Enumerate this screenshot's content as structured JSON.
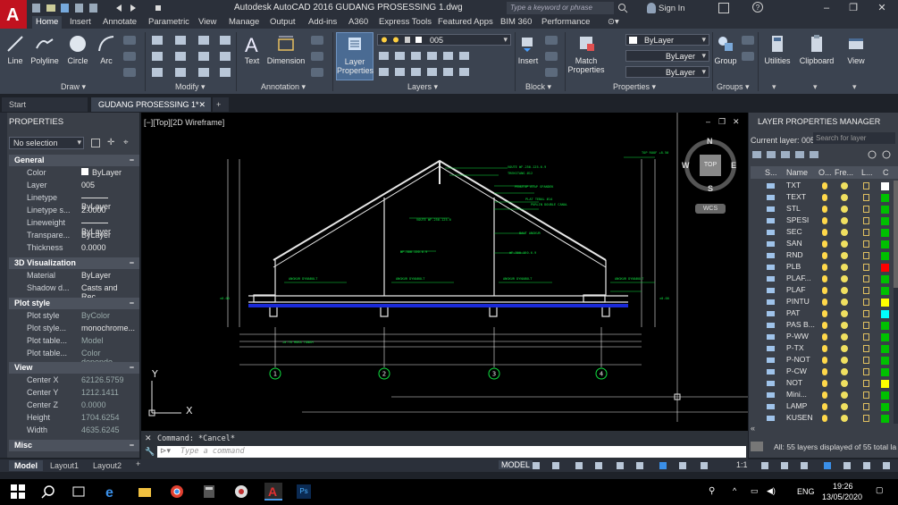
{
  "window": {
    "title": "Autodesk AutoCAD 2016    GUDANG PROSESSING 1.dwg",
    "search_placeholder": "Type a keyword or phrase",
    "sign_in": "Sign In"
  },
  "menu_tabs": [
    "Home",
    "Insert",
    "Annotate",
    "Parametric",
    "View",
    "Manage",
    "Output",
    "Add-ins",
    "A360",
    "Express Tools",
    "Featured Apps",
    "BIM 360",
    "Performance"
  ],
  "ribbon": {
    "draw_tools": [
      "Line",
      "Polyline",
      "Circle",
      "Arc"
    ],
    "annotation_tools": [
      "Text",
      "Dimension"
    ],
    "layer_properties": "Layer\nProperties",
    "layer_current": "005",
    "insert": "Insert",
    "match_properties": "Match\nProperties",
    "bylayer": "ByLayer",
    "group": "Group",
    "utilities": "Utilities",
    "clipboard": "Clipboard",
    "view": "View",
    "panels": [
      "Draw",
      "Modify",
      "Annotation",
      "Layers",
      "Block",
      "Properties",
      "Groups"
    ]
  },
  "doc_tabs": [
    "Start",
    "GUDANG PROSESSING 1*"
  ],
  "properties": {
    "title": "PROPERTIES",
    "selection": "No selection",
    "general": {
      "label": "General",
      "rows": [
        [
          "Color",
          "ByLayer"
        ],
        [
          "Layer",
          "005"
        ],
        [
          "Linetype",
          "ByLayer"
        ],
        [
          "Linetype s...",
          "2.0000"
        ],
        [
          "Lineweight",
          "ByLayer"
        ],
        [
          "Transpare...",
          "ByLayer"
        ],
        [
          "Thickness",
          "0.0000"
        ]
      ]
    },
    "viz": {
      "label": "3D Visualization",
      "rows": [
        [
          "Material",
          "ByLayer"
        ],
        [
          "Shadow d...",
          "Casts and Rec..."
        ]
      ]
    },
    "plot": {
      "label": "Plot style",
      "rows": [
        [
          "Plot style",
          "ByColor"
        ],
        [
          "Plot style...",
          "monochrome..."
        ],
        [
          "Plot table...",
          "Model"
        ],
        [
          "Plot table...",
          "Color depende..."
        ]
      ]
    },
    "view": {
      "label": "View",
      "rows": [
        [
          "Center X",
          "62126.5759"
        ],
        [
          "Center Y",
          "1212.1411"
        ],
        [
          "Center Z",
          "0.0000"
        ],
        [
          "Height",
          "1704.6254"
        ],
        [
          "Width",
          "4635.6245"
        ]
      ]
    },
    "misc": {
      "label": "Misc"
    }
  },
  "viewport_label": "[−][Top][2D Wireframe]",
  "viewcube": {
    "top": "TOP",
    "n": "N",
    "s": "S",
    "e": "E",
    "w": "W",
    "wcs": "WCS"
  },
  "command": {
    "history": "Command: *Cancel*",
    "placeholder": "Type a command"
  },
  "layer_manager": {
    "title": "LAYER PROPERTIES MANAGER",
    "current": "Current layer: 005",
    "search": "Search for layer",
    "headers": [
      "S...",
      "Name",
      "O...",
      "Fre...",
      "L...",
      "C"
    ],
    "layers": [
      {
        "name": "TXT",
        "color": "#ffffff"
      },
      {
        "name": "TEXT",
        "color": "#00c000"
      },
      {
        "name": "STL",
        "color": "#00c000"
      },
      {
        "name": "SPESI",
        "color": "#00c000"
      },
      {
        "name": "SEC",
        "color": "#00c000"
      },
      {
        "name": "SAN",
        "color": "#00c000"
      },
      {
        "name": "RND",
        "color": "#00c000"
      },
      {
        "name": "PLB",
        "color": "#ff0000"
      },
      {
        "name": "PLAF...",
        "color": "#00c000"
      },
      {
        "name": "PLAF",
        "color": "#00c000"
      },
      {
        "name": "PINTU",
        "color": "#ffff00"
      },
      {
        "name": "PAT",
        "color": "#00ffff"
      },
      {
        "name": "PAS B...",
        "color": "#00c000"
      },
      {
        "name": "P-WW",
        "color": "#00c000"
      },
      {
        "name": "P-TX",
        "color": "#00c000"
      },
      {
        "name": "P-NOT",
        "color": "#00c000"
      },
      {
        "name": "P-CW",
        "color": "#00c000"
      },
      {
        "name": "NOT",
        "color": "#ffff00"
      },
      {
        "name": "Mini...",
        "color": "#00c000"
      },
      {
        "name": "LAMP",
        "color": "#00c000"
      },
      {
        "name": "KUSEN",
        "color": "#00c000"
      }
    ],
    "footer": "All: 55 layers displayed of 55 total la"
  },
  "layout_tabs": [
    "Model",
    "Layout1",
    "Layout2"
  ],
  "status": {
    "model": "MODEL",
    "scale": "1:1"
  },
  "taskbar": {
    "lang": "ENG",
    "time": "19:26",
    "date": "13/05/2020"
  },
  "drawing_labels": {
    "grid": [
      "1",
      "2",
      "3",
      "4"
    ],
    "x": "X",
    "y": "Y"
  }
}
